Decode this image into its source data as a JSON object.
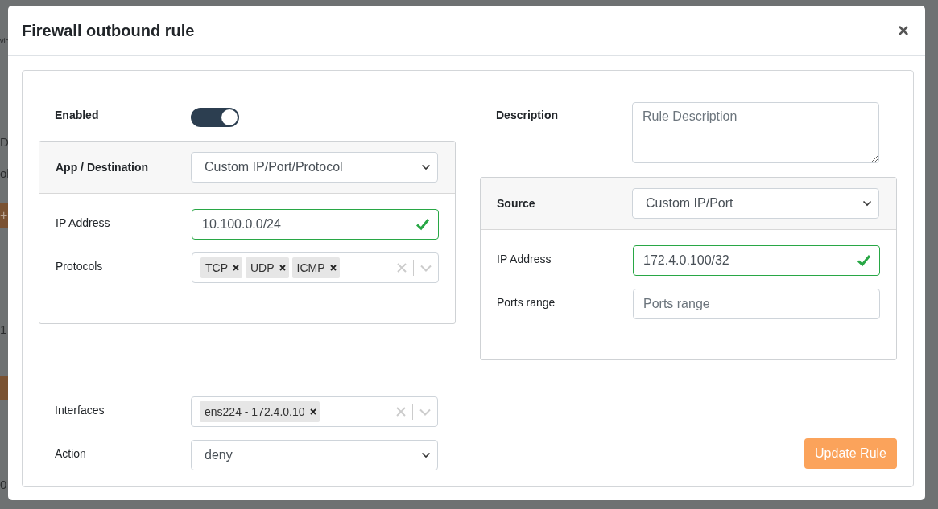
{
  "backdrop": [
    {
      "kind": "text",
      "text": "vic"
    },
    {
      "kind": "text",
      "text": "D"
    },
    {
      "kind": "text",
      "text": "ol"
    },
    {
      "kind": "button",
      "text": "+"
    },
    {
      "kind": "text",
      "text": "1"
    },
    {
      "kind": "button"
    },
    {
      "kind": "text",
      "text": "0"
    }
  ],
  "window": {
    "title": "Firewall outbound rule",
    "close": "×"
  },
  "enabled": {
    "label": "Enabled",
    "on": true
  },
  "description": {
    "label": "Description",
    "placeholder": "Rule Description"
  },
  "destination": {
    "label": "App / Destination",
    "select": "Custom IP/Port/Protocol",
    "ip": {
      "label": "IP Address",
      "value": "10.100.0.0/24",
      "valid": true
    },
    "protocols": {
      "label": "Protocols",
      "tags": [
        "TCP",
        "UDP",
        "ICMP"
      ]
    }
  },
  "source": {
    "label": "Source",
    "select": "Custom IP/Port",
    "ip": {
      "label": "IP Address",
      "value": "172.4.0.100/32",
      "valid": true
    },
    "ports": {
      "label": "Ports range",
      "placeholder": "Ports range"
    }
  },
  "interfaces": {
    "label": "Interfaces",
    "tags": [
      "ens224 - 172.4.0.10"
    ]
  },
  "action": {
    "label": "Action",
    "value": "deny"
  },
  "submit": "Update Rule"
}
